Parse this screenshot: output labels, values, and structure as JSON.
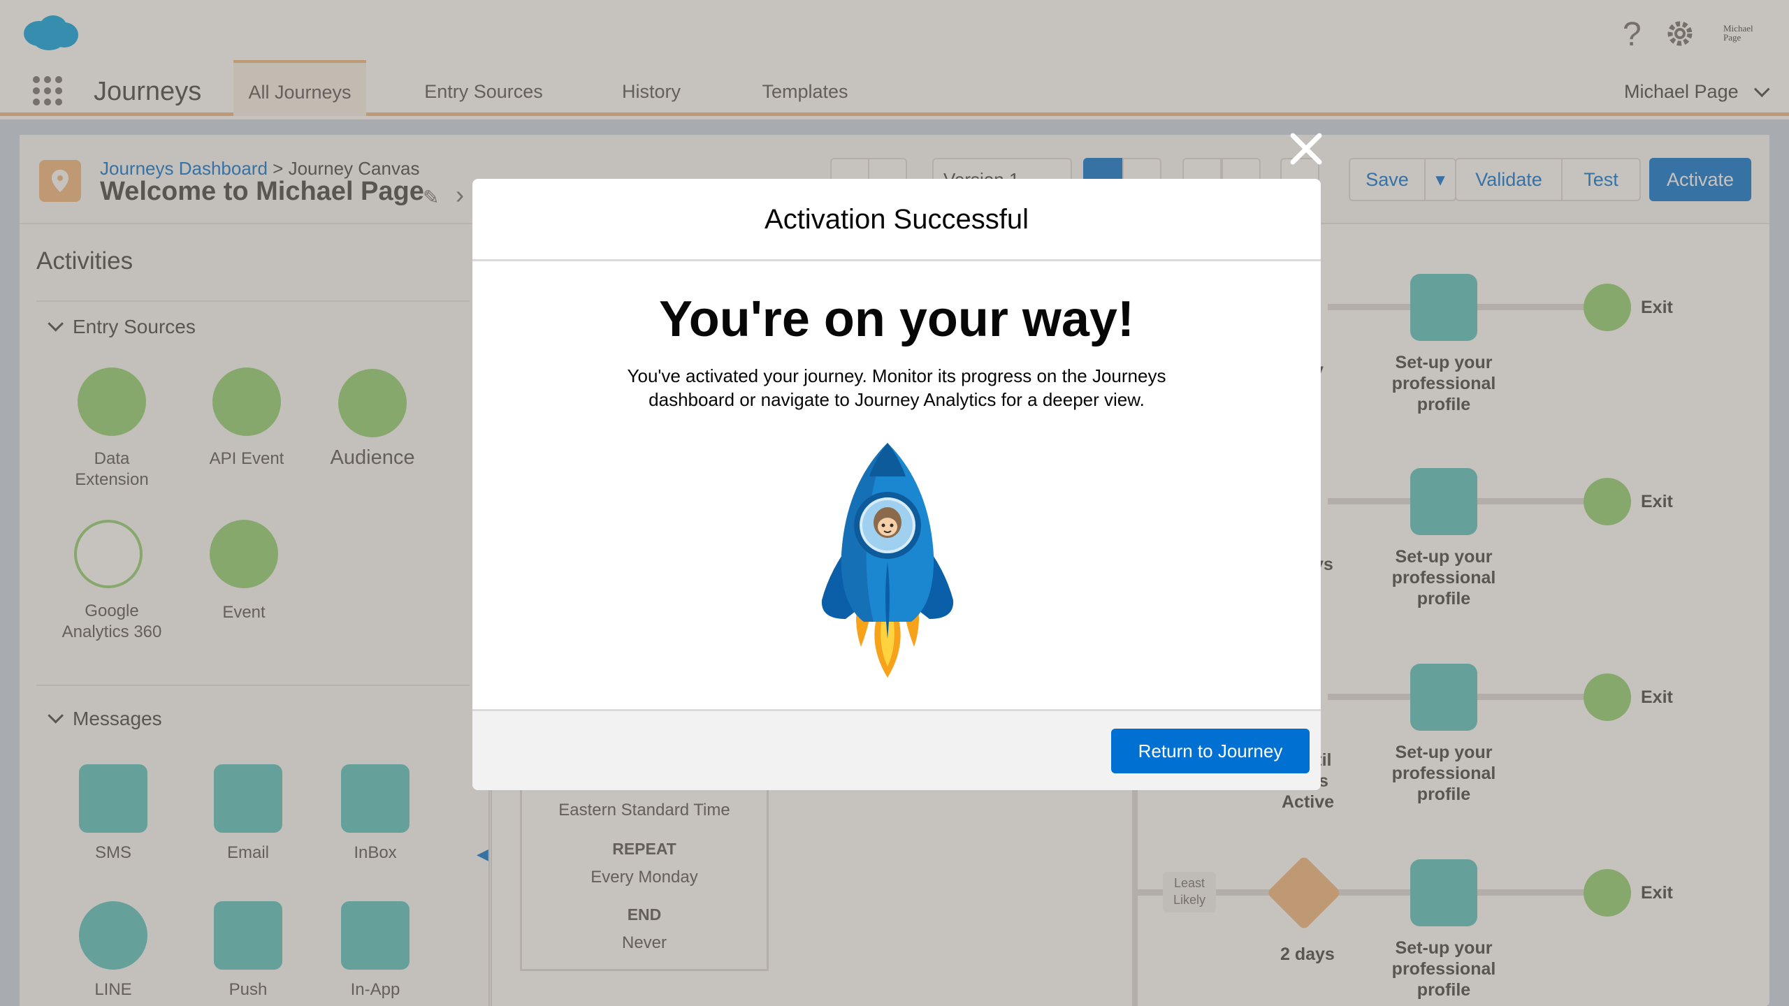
{
  "header": {
    "app_name": "Journeys",
    "tabs": [
      "All Journeys",
      "Entry Sources",
      "History",
      "Templates"
    ],
    "user_name": "Michael Page",
    "avatar_text": "Michael Page",
    "help_icon": "help-icon",
    "settings_icon": "gear-icon"
  },
  "toolbar": {
    "breadcrumb_link": "Journeys Dashboard",
    "breadcrumb_sep": " > ",
    "breadcrumb_current": "Journey Canvas",
    "journey_name": "Welcome to Michael Page",
    "version_label": "Version 1",
    "save_label": "Save",
    "validate_label": "Validate",
    "test_label": "Test",
    "activate_label": "Activate"
  },
  "activities": {
    "title": "Activities",
    "entry_sources_heading": "Entry Sources",
    "entry_sources": [
      {
        "label": "Data\nExtension",
        "icon": "data-extension-icon"
      },
      {
        "label": "API Event",
        "icon": "api-event-icon"
      },
      {
        "label": "Audience",
        "icon": "audience-icon"
      },
      {
        "label": "Google\nAnalytics 360",
        "icon": "google-analytics-icon"
      },
      {
        "label": "Event",
        "icon": "event-icon"
      }
    ],
    "messages_heading": "Messages",
    "messages": [
      {
        "label": "SMS",
        "icon": "sms-icon"
      },
      {
        "label": "Email",
        "icon": "email-icon"
      },
      {
        "label": "InBox",
        "icon": "inbox-icon"
      },
      {
        "label": "LINE",
        "icon": "line-icon"
      },
      {
        "label": "Push",
        "icon": "push-icon"
      },
      {
        "label": "In-App",
        "icon": "in-app-icon"
      }
    ]
  },
  "schedule": {
    "timezone": "Eastern Standard Time",
    "repeat_label": "REPEAT",
    "repeat_value": "Every Monday",
    "end_label": "END",
    "end_value": "Never"
  },
  "canvas": {
    "email_label": "Set-up your professional profile",
    "exit_label": "Exit",
    "partial_labels": [
      "y",
      "ys",
      "ntil",
      "is",
      "Active"
    ],
    "least_likely": "Least Likely",
    "wait_label": "2 days"
  },
  "modal": {
    "title": "Activation Successful",
    "headline": "You're on your way!",
    "body_line1": "You've activated your journey. Monitor its progress on the Journeys",
    "body_line2": "dashboard or navigate to Journey Analytics for a deeper view.",
    "button": "Return to Journey",
    "illustration": "rocket-astro-illustration"
  },
  "colors": {
    "brand_blue": "#0070d2",
    "teal": "#54c3c1",
    "green": "#8ed16f",
    "orange": "#f2b77a"
  }
}
